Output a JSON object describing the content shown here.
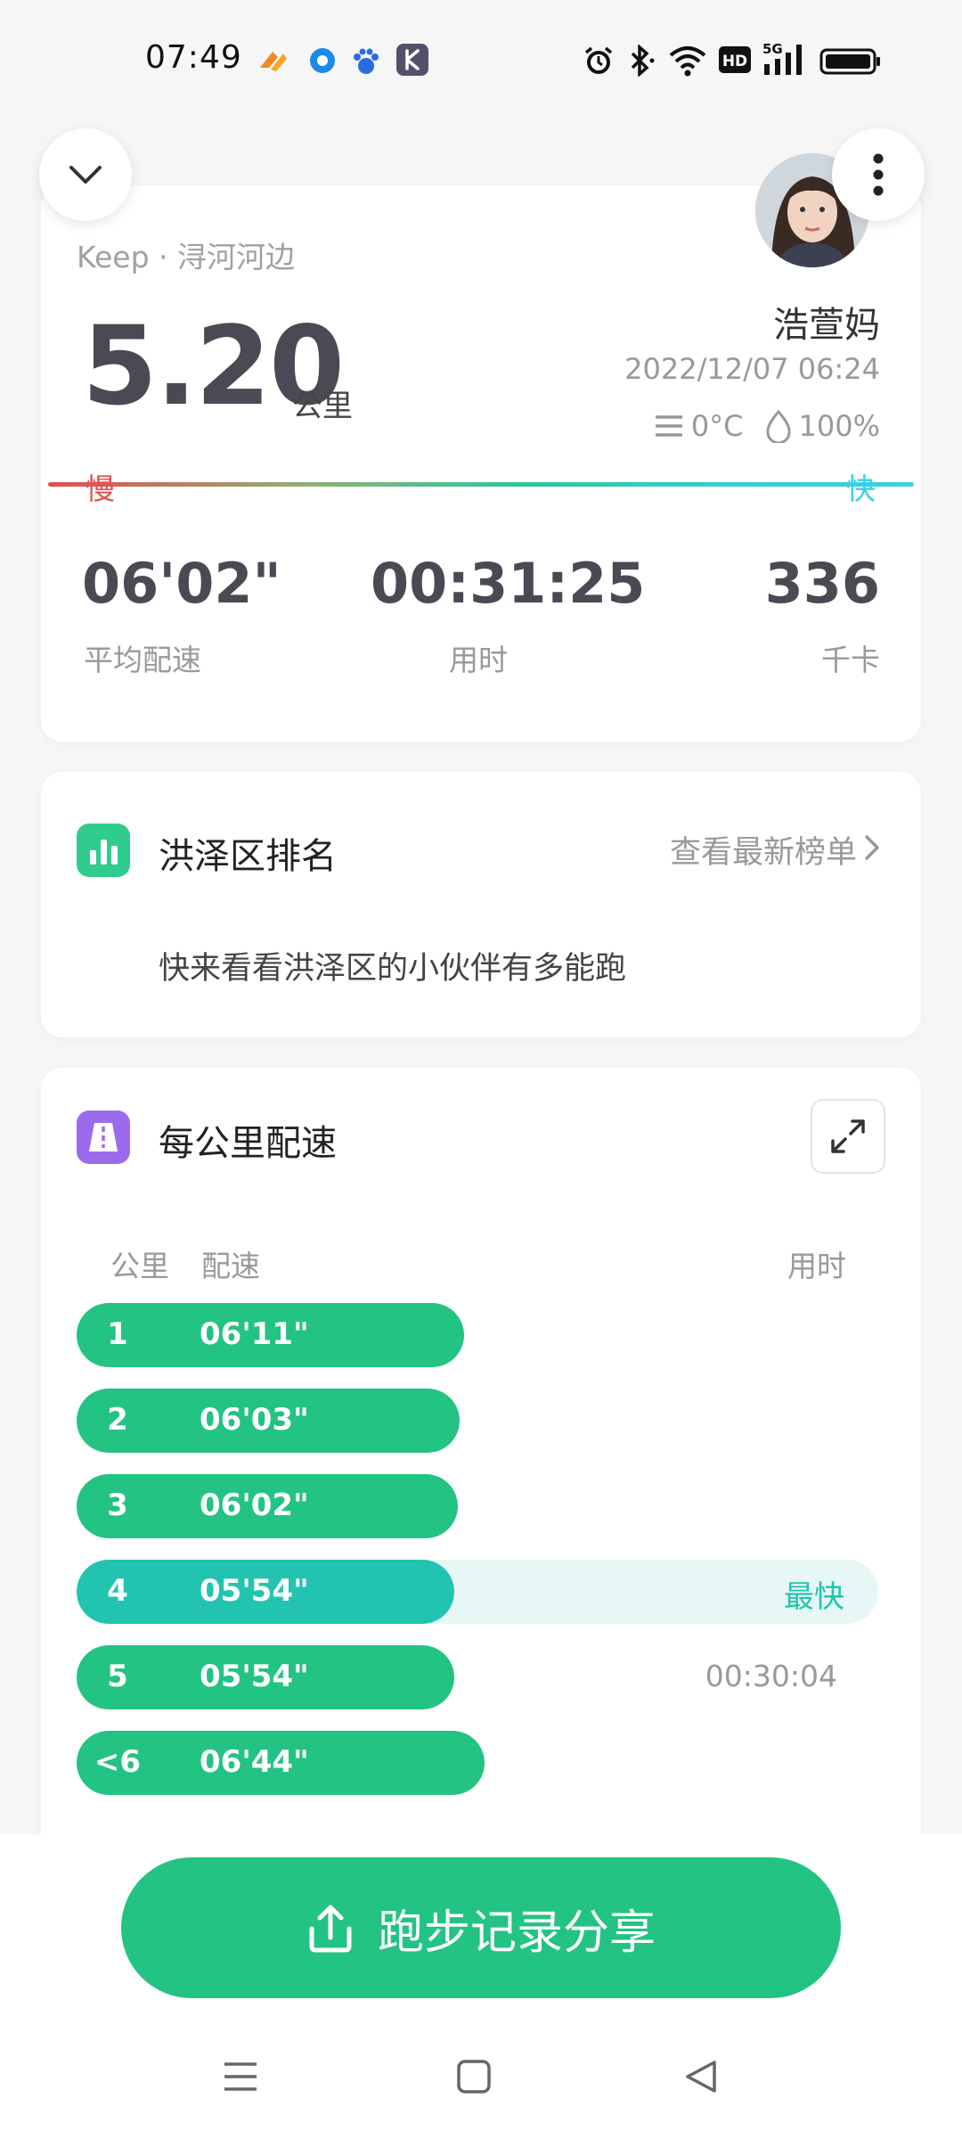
{
  "status_bar": {
    "time": "07:49",
    "network": "5G",
    "hd": "HD"
  },
  "summary": {
    "source": "Keep · 浔河河边",
    "distance": "5.20",
    "distance_unit": "公里",
    "user_name": "浩萱妈",
    "datetime": "2022/12/07 06:24",
    "temperature": "0°C",
    "humidity": "100%",
    "slow_label": "慢",
    "fast_label": "快",
    "stats": [
      {
        "value": "06'02\"",
        "label": "平均配速"
      },
      {
        "value": "00:31:25",
        "label": "用时"
      },
      {
        "value": "336",
        "label": "千卡"
      }
    ]
  },
  "ranking": {
    "title": "洪泽区排名",
    "link": "查看最新榜单",
    "desc": "快来看看洪泽区的小伙伴有多能跑"
  },
  "pace": {
    "title": "每公里配速",
    "col_km": "公里",
    "col_pace": "配速",
    "col_time": "用时",
    "rows": [
      {
        "km": "1",
        "pace": "06'11\"",
        "note": "",
        "fill": 0.483
      },
      {
        "km": "2",
        "pace": "06'03\"",
        "note": "",
        "fill": 0.478
      },
      {
        "km": "3",
        "pace": "06'02\"",
        "note": "",
        "fill": 0.476
      },
      {
        "km": "4",
        "pace": "05'54\"",
        "note": "最快",
        "fill": 0.471
      },
      {
        "km": "5",
        "pace": "05'54\"",
        "note": "00:30:04",
        "fill": 0.471
      },
      {
        "km": "<6",
        "pace": "06'44\"",
        "note": "",
        "fill": 0.509
      }
    ]
  },
  "share_button": "跑步记录分享",
  "colors": {
    "brand_green": "#23c383",
    "fastest_teal": "#22c4b0",
    "slow_red": "#e05050",
    "fast_cyan": "#3ad0e8"
  }
}
